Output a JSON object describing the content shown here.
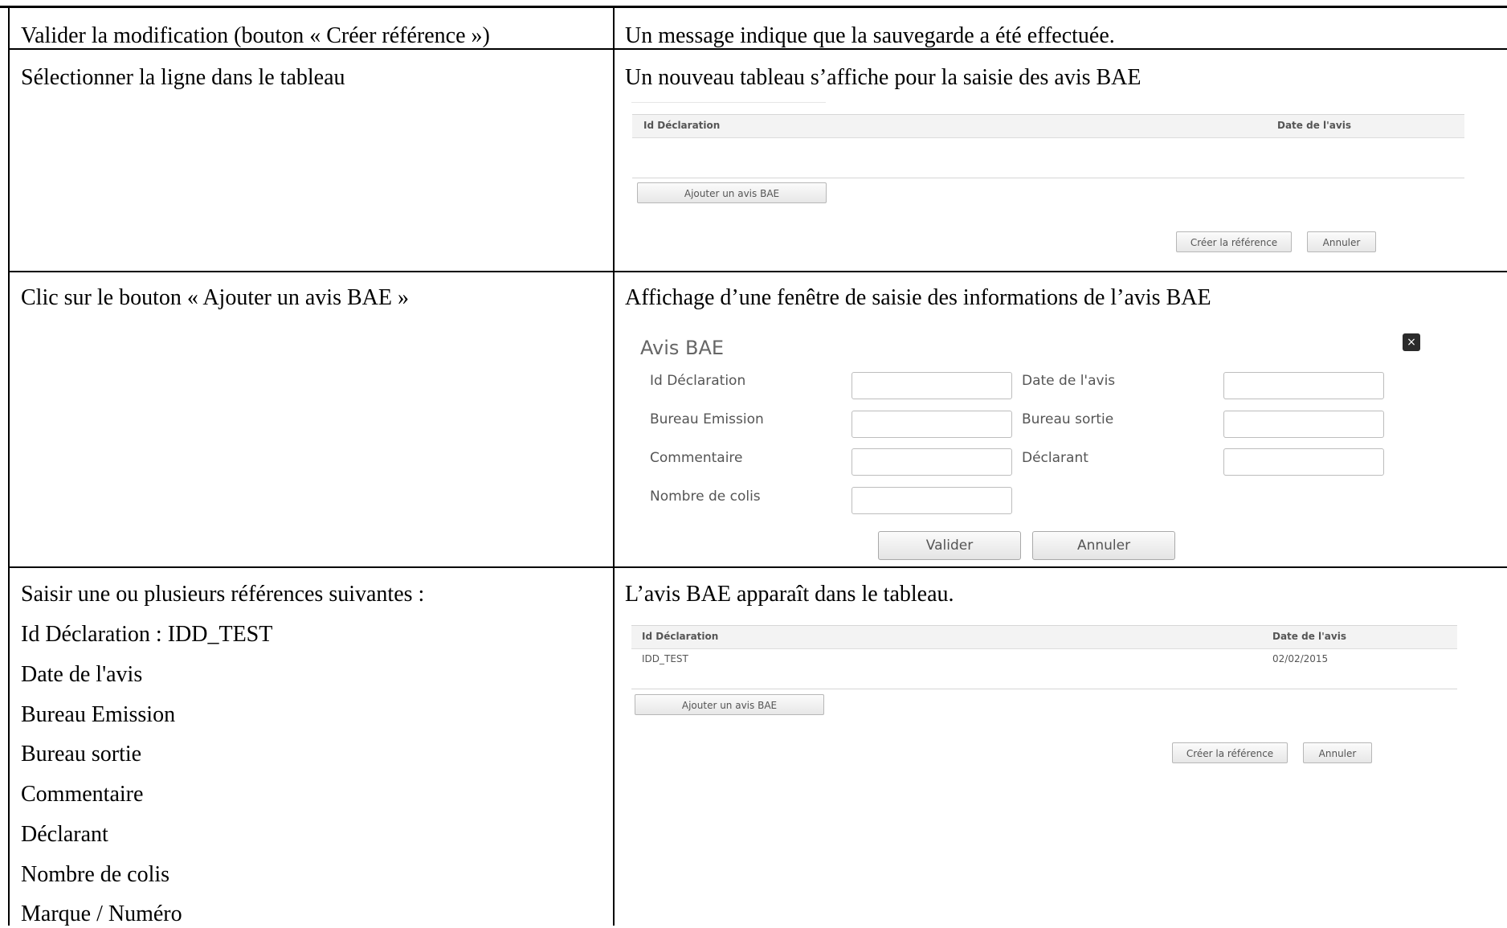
{
  "rows": [
    {
      "action": "Valider la modification (bouton « Créer référence »)",
      "result": "Un message indique que la sauvegarde a été effectuée."
    },
    {
      "action": "Sélectionner la ligne dans le tableau",
      "result": "Un nouveau tableau s’affiche pour la saisie des avis BAE",
      "screenshot": {
        "col_id": "Id Déclaration",
        "col_date": "Date de l'avis",
        "add_button": "Ajouter un avis BAE",
        "create_button": "Créer la référence",
        "cancel_button": "Annuler"
      }
    },
    {
      "action": "Clic sur le bouton « Ajouter un avis BAE »",
      "result": "Affichage d’une fenêtre de saisie des informations de l’avis BAE",
      "modal": {
        "title": "Avis BAE",
        "close": "×",
        "fields": {
          "id_declaration": "Id Déclaration",
          "date_avis": "Date de l'avis",
          "bureau_emission": "Bureau Emission",
          "bureau_sortie": "Bureau sortie",
          "commentaire": "Commentaire",
          "declarant": "Déclarant",
          "nombre_colis": "Nombre de colis"
        },
        "validate_button": "Valider",
        "cancel_button": "Annuler"
      }
    },
    {
      "action": "Saisir une ou plusieurs références suivantes :",
      "action_items": [
        "Id Déclaration : IDD_TEST",
        "Date de l'avis",
        "Bureau Emission",
        "Bureau sortie",
        "Commentaire",
        "Déclarant",
        "Nombre de colis",
        "Marque / Numéro"
      ],
      "result": "L’avis BAE apparaît dans le tableau.",
      "screenshot": {
        "col_id": "Id Déclaration",
        "col_date": "Date de l'avis",
        "row_id": "IDD_TEST",
        "row_date": "02/02/2015",
        "add_button": "Ajouter un avis BAE",
        "create_button": "Créer la référence",
        "cancel_button": "Annuler"
      }
    }
  ]
}
